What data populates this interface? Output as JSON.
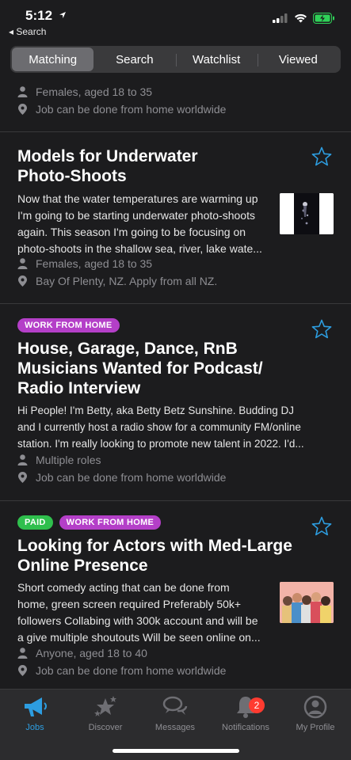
{
  "status": {
    "time": "5:12",
    "back_app": "◂ Search"
  },
  "tabs": [
    {
      "label": "Matching",
      "active": true
    },
    {
      "label": "Search",
      "active": false
    },
    {
      "label": "Watchlist",
      "active": false
    },
    {
      "label": "Viewed",
      "active": false
    }
  ],
  "listings": [
    {
      "title_partial": "",
      "desc_partial": "",
      "meta_person": "Females, aged 18 to 35",
      "meta_location": "Job can be done from home worldwide"
    },
    {
      "title": [
        "Models for Underwater",
        "Photo-Shoots"
      ],
      "desc": [
        "Now that the water temperatures are warming up",
        "I'm going to be starting underwater photo-shoots",
        "again. This season I'm going to be focusing on",
        "photo-shoots in the shallow sea, river, lake wate..."
      ],
      "meta_person": "Females, aged 18 to 35",
      "meta_location": "Bay Of Plenty, NZ. Apply from all NZ."
    },
    {
      "badges": [
        "WORK FROM HOME"
      ],
      "title": [
        "House, Garage, Dance, RnB",
        "Musicians Wanted for Podcast/",
        "Radio Interview"
      ],
      "desc": [
        "Hi People! I'm Betty, aka Betty Betz Sunshine. Budding DJ",
        "and I currently host a radio show for a community FM/online",
        "station. I'm really looking to promote new talent in 2022. I'd..."
      ],
      "meta_person": "Multiple roles",
      "meta_location": "Job can be done from home worldwide"
    },
    {
      "badges": [
        "PAID",
        "WORK FROM HOME"
      ],
      "title": [
        "Looking for Actors with Med-Large",
        "Online Presence"
      ],
      "desc": [
        "Short comedy acting that can be done from",
        "home, green screen required Preferably 50k+",
        "followers Collabing with 300k account and will be",
        "a give multiple shoutouts Will be seen online on..."
      ],
      "meta_person": "Anyone, aged 18 to 40",
      "meta_location": "Job can be done from home worldwide"
    }
  ],
  "nav": [
    {
      "label": "Jobs",
      "icon": "megaphone-icon",
      "active": true
    },
    {
      "label": "Discover",
      "icon": "stars-icon",
      "active": false
    },
    {
      "label": "Messages",
      "icon": "chat-bubbles-icon",
      "active": false
    },
    {
      "label": "Notifications",
      "icon": "bell-icon",
      "active": false,
      "badge": "2"
    },
    {
      "label": "My Profile",
      "icon": "profile-icon",
      "active": false
    }
  ],
  "colors": {
    "accent": "#2d9de0",
    "wfh_badge": "#b43fc8",
    "paid_badge": "#2fbf4d",
    "background": "#1c1c1e"
  }
}
